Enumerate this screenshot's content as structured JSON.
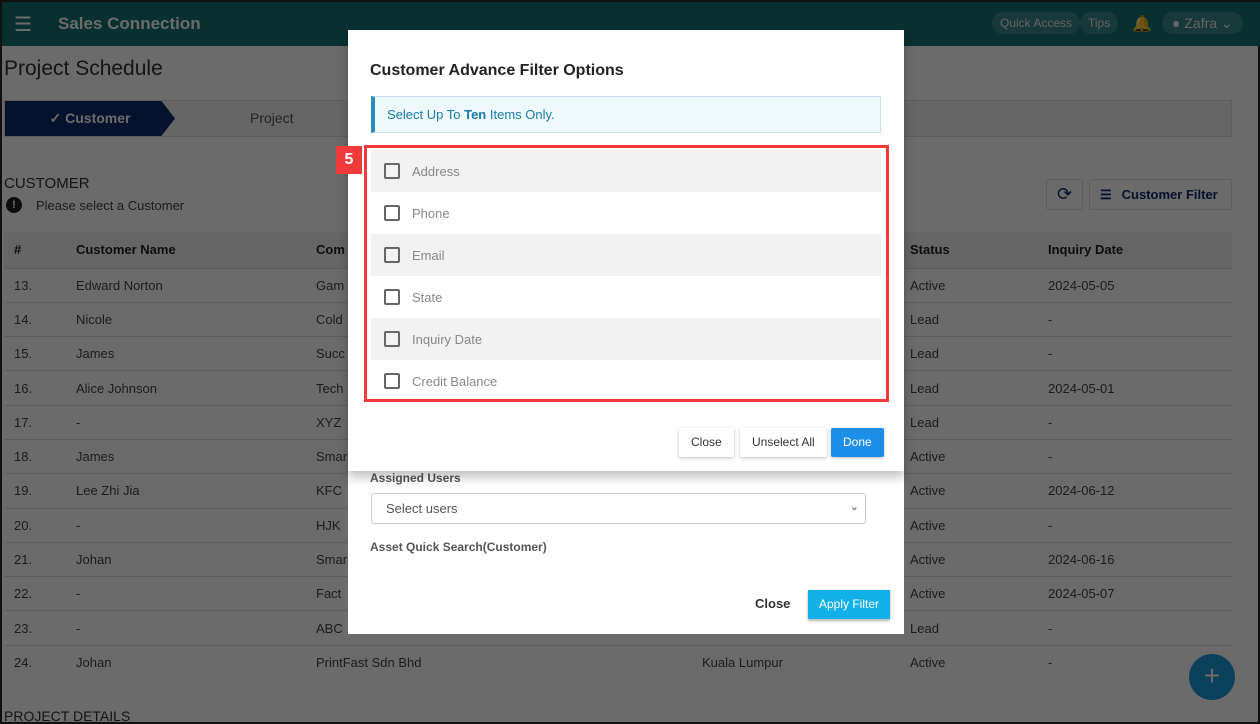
{
  "topbar": {
    "brand": "Sales Connection",
    "quick_access": "Quick Access",
    "tips": "Tips",
    "user": "Zafra"
  },
  "page": {
    "title": "Project Schedule",
    "steps": [
      "✓ Customer",
      "Project"
    ],
    "section": "CUSTOMER",
    "hint": "Please select a Customer",
    "refresh_icon": "refresh-icon",
    "filter_label": "Customer Filter",
    "project_details": "PROJECT DETAILS"
  },
  "table": {
    "headers": [
      "#",
      "Customer Name",
      "Com",
      "",
      "Status",
      "Inquiry Date"
    ],
    "rows": [
      [
        "13.",
        "Edward Norton",
        "Gam",
        "",
        "Active",
        "2024-05-05"
      ],
      [
        "14.",
        "Nicole",
        "Cold",
        "",
        "Lead",
        "-"
      ],
      [
        "15.",
        "James",
        "Succ",
        "",
        "Lead",
        "-"
      ],
      [
        "16.",
        "Alice Johnson",
        "Tech",
        "",
        "Lead",
        "2024-05-01"
      ],
      [
        "17.",
        "-",
        "XYZ",
        "",
        "Lead",
        "-"
      ],
      [
        "18.",
        "James",
        "Smar",
        "",
        "Active",
        "-"
      ],
      [
        "19.",
        "Lee Zhi Jia",
        "KFC",
        "",
        "Active",
        "2024-06-12"
      ],
      [
        "20.",
        "-",
        "HJK",
        "",
        "Active",
        "-"
      ],
      [
        "21.",
        "Johan",
        "Smar",
        "",
        "Active",
        "2024-06-16"
      ],
      [
        "22.",
        "-",
        "Fact",
        "",
        "Active",
        "2024-05-07"
      ],
      [
        "23.",
        "-",
        "ABC",
        "",
        "Lead",
        "-"
      ],
      [
        "24.",
        "Johan",
        "PrintFast Sdn Bhd",
        "Kuala Lumpur",
        "Active",
        "-"
      ]
    ]
  },
  "modal": {
    "title": "Customer Advance Filter Options",
    "info_prefix": "Select Up To ",
    "info_bold": "Ten",
    "info_suffix": " Items Only.",
    "annotation": "5",
    "options": [
      "Address",
      "Phone",
      "Email",
      "State",
      "Inquiry Date",
      "Credit Balance"
    ],
    "close": "Close",
    "unselect_all": "Unselect All",
    "done": "Done",
    "assigned_users_label": "Assigned Users",
    "select_users": "Select users",
    "asset_search_label": "Asset Quick Search(Customer)",
    "close2": "Close",
    "apply": "Apply Filter"
  },
  "colors": {
    "primary": "#0d2a6b",
    "teal": "#137373",
    "done": "#1e8fe8",
    "apply": "#12b0e8",
    "annotation": "#f03a3a"
  }
}
